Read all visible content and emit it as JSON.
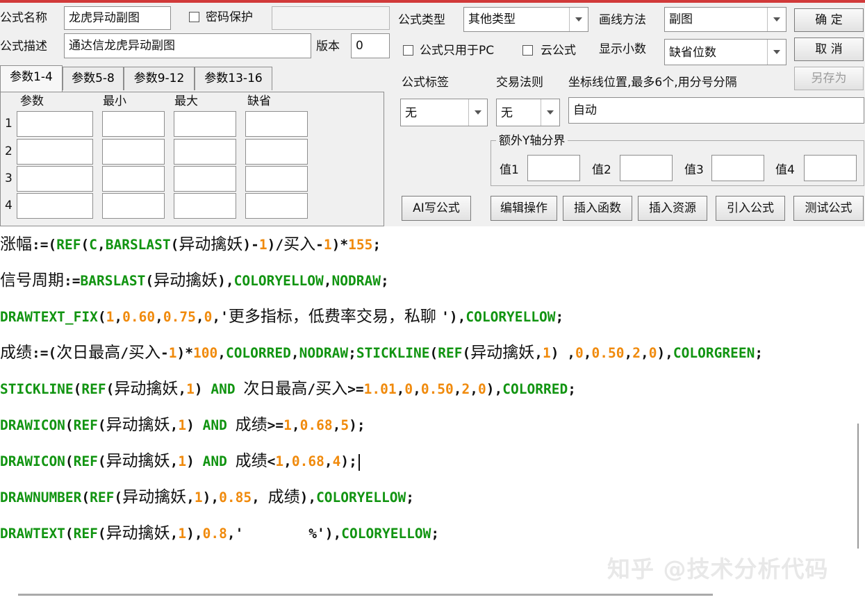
{
  "header": {
    "formula_name_label": "公式名称",
    "formula_name_value": "龙虎异动副图",
    "password_label": "密码保护",
    "formula_desc_label": "公式描述",
    "formula_desc_value": "通达信龙虎异动副图",
    "version_label": "版本",
    "version_value": "0",
    "formula_type_label": "公式类型",
    "formula_type_value": "其他类型",
    "draw_method_label": "画线方法",
    "draw_method_value": "副图",
    "pc_only_label": "公式只用于PC",
    "cloud_label": "云公式",
    "decimal_label": "显示小数",
    "decimal_value": "缺省位数",
    "tag_label": "公式标签",
    "tag_value": "无",
    "trade_rule_label": "交易法则",
    "trade_rule_value": "无",
    "axis_label": "坐标线位置,最多6个,用分号分隔",
    "axis_value": "自动",
    "extra_y_label": "额外Y轴分界",
    "extra_y_values": [
      "值1",
      "值2",
      "值3",
      "值4"
    ]
  },
  "buttons": {
    "ok": "确 定",
    "cancel": "取 消",
    "save_as": "另存为",
    "ai": "AI写公式",
    "edit": "编辑操作",
    "insert_func": "插入函数",
    "insert_res": "插入资源",
    "import": "引入公式",
    "test": "测试公式"
  },
  "tabs": [
    "参数1-4",
    "参数5-8",
    "参数9-12",
    "参数13-16"
  ],
  "params": {
    "headers": [
      "参数",
      "最小",
      "最大",
      "缺省"
    ],
    "rows": [
      "1",
      "2",
      "3",
      "4"
    ]
  },
  "code_lines": [
    [
      [
        "t",
        "涨幅"
      ],
      [
        "p",
        ":=("
      ],
      [
        "k",
        "REF"
      ],
      [
        "p",
        "("
      ],
      [
        "k",
        "C"
      ],
      [
        "p",
        ","
      ],
      [
        "k",
        "BARSLAST"
      ],
      [
        "p",
        "("
      ],
      [
        "t",
        "异动擒妖"
      ],
      [
        "p",
        ")-"
      ],
      [
        "n",
        "1"
      ],
      [
        "p",
        ")/"
      ],
      [
        "t",
        "买入"
      ],
      [
        "p",
        "-"
      ],
      [
        "n",
        "1"
      ],
      [
        "p",
        ")*"
      ],
      [
        "n",
        "155"
      ],
      [
        "p",
        ";"
      ]
    ],
    [
      [
        "t",
        "信号周期"
      ],
      [
        "p",
        ":="
      ],
      [
        "k",
        "BARSLAST"
      ],
      [
        "p",
        "("
      ],
      [
        "t",
        "异动擒妖"
      ],
      [
        "p",
        "),"
      ],
      [
        "k",
        "COLORYELLOW"
      ],
      [
        "p",
        ","
      ],
      [
        "k",
        "NODRAW"
      ],
      [
        "p",
        ";"
      ]
    ],
    [
      [
        "k",
        "DRAWTEXT_FIX"
      ],
      [
        "p",
        "("
      ],
      [
        "n",
        "1"
      ],
      [
        "p",
        ","
      ],
      [
        "n",
        "0.60"
      ],
      [
        "p",
        ","
      ],
      [
        "n",
        "0.75"
      ],
      [
        "p",
        ","
      ],
      [
        "n",
        "0"
      ],
      [
        "p",
        ",'"
      ],
      [
        "t",
        "更多指标，低费率交易，私聊 "
      ],
      [
        "p",
        "'),"
      ],
      [
        "k",
        "COLORYELLOW"
      ],
      [
        "p",
        ";"
      ]
    ],
    [
      [
        "t",
        "成绩"
      ],
      [
        "p",
        ":=("
      ],
      [
        "t",
        "次日最高"
      ],
      [
        "p",
        "/"
      ],
      [
        "t",
        "买入"
      ],
      [
        "p",
        "-"
      ],
      [
        "n",
        "1"
      ],
      [
        "p",
        ")*"
      ],
      [
        "n",
        "100"
      ],
      [
        "p",
        ","
      ],
      [
        "k",
        "COLORRED"
      ],
      [
        "p",
        ","
      ],
      [
        "k",
        "NODRAW"
      ],
      [
        "p",
        ";"
      ],
      [
        "k",
        "STICKLINE"
      ],
      [
        "p",
        "("
      ],
      [
        "k",
        "REF"
      ],
      [
        "p",
        "("
      ],
      [
        "t",
        "异动擒妖"
      ],
      [
        "p",
        ","
      ],
      [
        "n",
        "1"
      ],
      [
        "p",
        ") ,"
      ],
      [
        "n",
        "0"
      ],
      [
        "p",
        ","
      ],
      [
        "n",
        "0.50"
      ],
      [
        "p",
        ","
      ],
      [
        "n",
        "2"
      ],
      [
        "p",
        ","
      ],
      [
        "n",
        "0"
      ],
      [
        "p",
        "),"
      ],
      [
        "k",
        "COLORGREEN"
      ],
      [
        "p",
        ";"
      ]
    ],
    [
      [
        "k",
        "STICKLINE"
      ],
      [
        "p",
        "("
      ],
      [
        "k",
        "REF"
      ],
      [
        "p",
        "("
      ],
      [
        "t",
        "异动擒妖"
      ],
      [
        "p",
        ","
      ],
      [
        "n",
        "1"
      ],
      [
        "p",
        ") "
      ],
      [
        "k",
        "AND"
      ],
      [
        "p",
        " "
      ],
      [
        "t",
        "次日最高"
      ],
      [
        "p",
        "/"
      ],
      [
        "t",
        "买入"
      ],
      [
        "p",
        ">="
      ],
      [
        "n",
        "1.01"
      ],
      [
        "p",
        ","
      ],
      [
        "n",
        "0"
      ],
      [
        "p",
        ","
      ],
      [
        "n",
        "0.50"
      ],
      [
        "p",
        ","
      ],
      [
        "n",
        "2"
      ],
      [
        "p",
        ","
      ],
      [
        "n",
        "0"
      ],
      [
        "p",
        "),"
      ],
      [
        "k",
        "COLORRED"
      ],
      [
        "p",
        ";"
      ]
    ],
    [
      [
        "k",
        "DRAWICON"
      ],
      [
        "p",
        "("
      ],
      [
        "k",
        "REF"
      ],
      [
        "p",
        "("
      ],
      [
        "t",
        "异动擒妖"
      ],
      [
        "p",
        ","
      ],
      [
        "n",
        "1"
      ],
      [
        "p",
        ") "
      ],
      [
        "k",
        "AND"
      ],
      [
        "p",
        " "
      ],
      [
        "t",
        "成绩"
      ],
      [
        "p",
        ">="
      ],
      [
        "n",
        "1"
      ],
      [
        "p",
        ","
      ],
      [
        "n",
        "0.68"
      ],
      [
        "p",
        ","
      ],
      [
        "n",
        "5"
      ],
      [
        "p",
        ");"
      ]
    ],
    [
      [
        "k",
        "DRAWICON"
      ],
      [
        "p",
        "("
      ],
      [
        "k",
        "REF"
      ],
      [
        "p",
        "("
      ],
      [
        "t",
        "异动擒妖"
      ],
      [
        "p",
        ","
      ],
      [
        "n",
        "1"
      ],
      [
        "p",
        ") "
      ],
      [
        "k",
        "AND"
      ],
      [
        "p",
        " "
      ],
      [
        "t",
        "成绩"
      ],
      [
        "p",
        "<"
      ],
      [
        "n",
        "1"
      ],
      [
        "p",
        ","
      ],
      [
        "n",
        "0.68"
      ],
      [
        "p",
        ","
      ],
      [
        "n",
        "4"
      ],
      [
        "p",
        ");"
      ]
    ],
    [
      [
        "k",
        "DRAWNUMBER"
      ],
      [
        "p",
        "("
      ],
      [
        "k",
        "REF"
      ],
      [
        "p",
        "("
      ],
      [
        "t",
        "异动擒妖"
      ],
      [
        "p",
        ","
      ],
      [
        "n",
        "1"
      ],
      [
        "p",
        "),"
      ],
      [
        "n",
        "0.85"
      ],
      [
        "p",
        ", "
      ],
      [
        "t",
        "成绩"
      ],
      [
        "p",
        "),"
      ],
      [
        "k",
        "COLORYELLOW"
      ],
      [
        "p",
        ";"
      ]
    ],
    [
      [
        "k",
        "DRAWTEXT"
      ],
      [
        "p",
        "("
      ],
      [
        "k",
        "REF"
      ],
      [
        "p",
        "("
      ],
      [
        "t",
        "异动擒妖"
      ],
      [
        "p",
        ","
      ],
      [
        "n",
        "1"
      ],
      [
        "p",
        "),"
      ],
      [
        "n",
        "0.8"
      ],
      [
        "p",
        ",'        %'),"
      ],
      [
        "k",
        "COLORYELLOW"
      ],
      [
        "p",
        ";"
      ]
    ]
  ],
  "watermark": "知乎 @技术分析代码",
  "colors": {
    "keyword": "#119411",
    "number": "#f08a0c",
    "accent_top": "#d13a3a"
  }
}
